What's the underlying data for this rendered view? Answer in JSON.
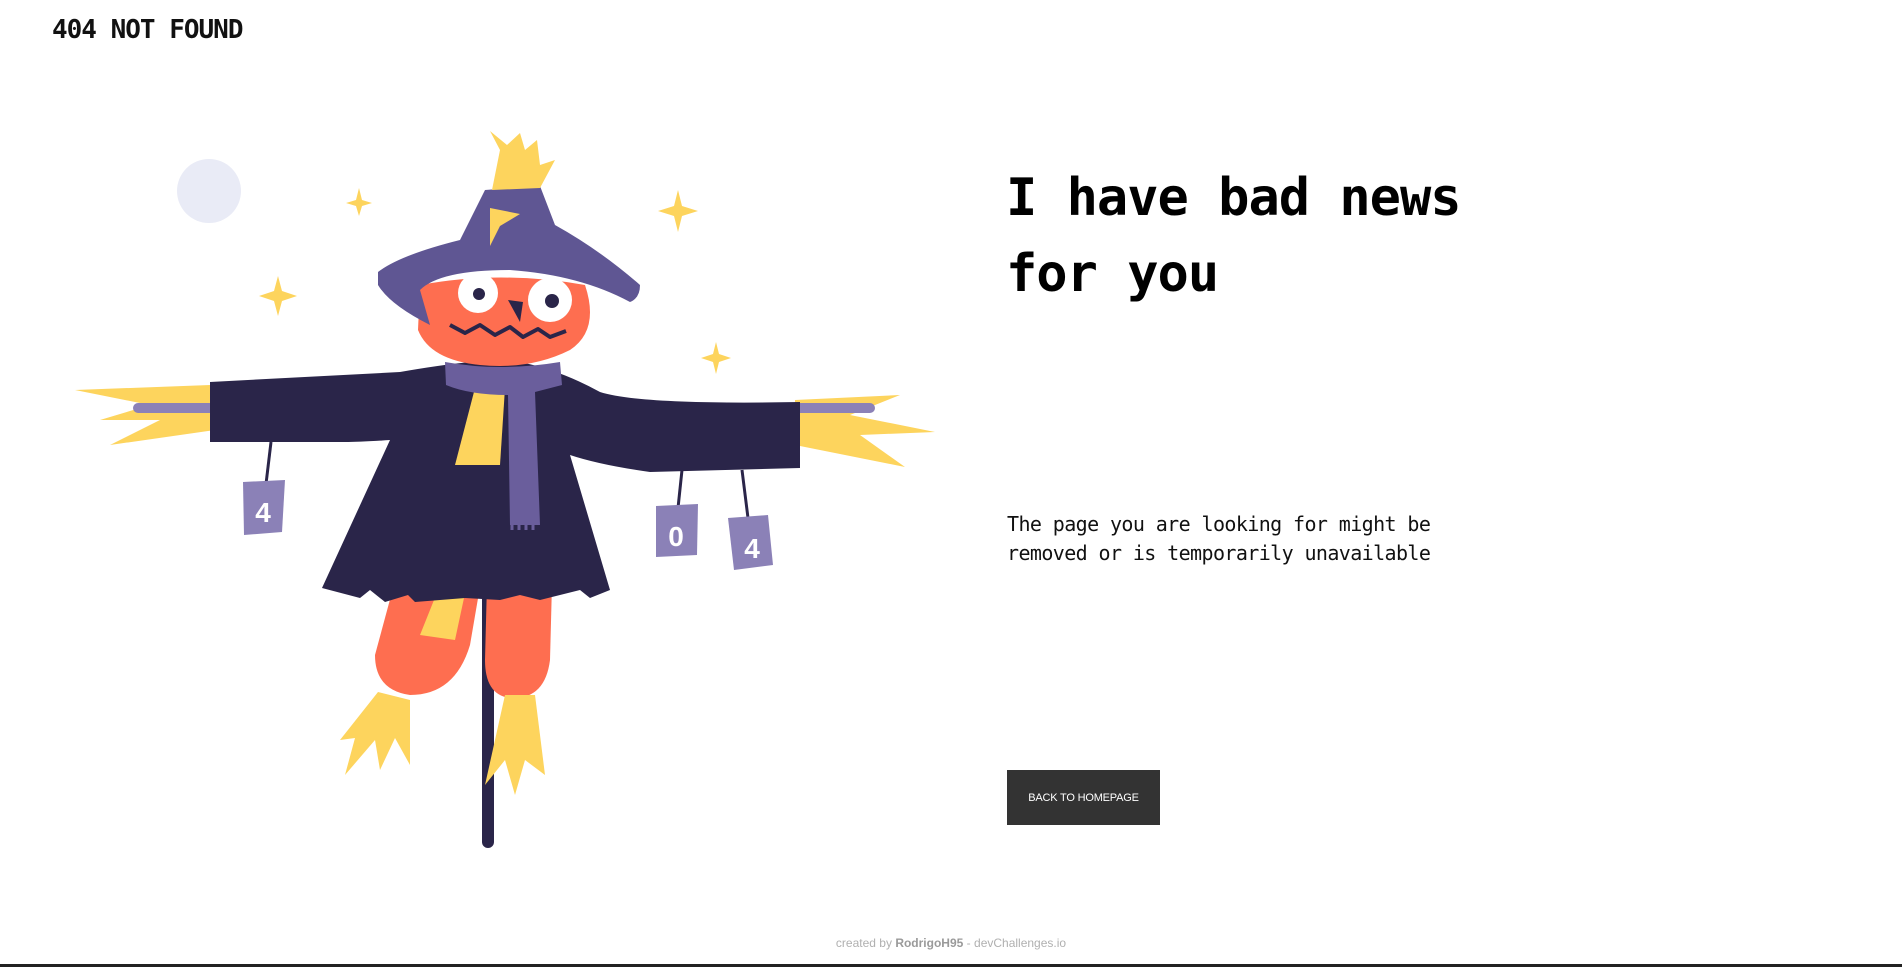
{
  "brand": {
    "label": "404 NOT FOUND"
  },
  "main": {
    "headline": "I have bad news for you",
    "message": "The page you are looking for might be removed or is temporarily unavailable",
    "cta_label": "BACK TO HOMEPAGE"
  },
  "illustration": {
    "can_labels": [
      "4",
      "0",
      "4"
    ]
  },
  "footer": {
    "prefix": "created by",
    "author": "RodrigoH95",
    "separator": "-",
    "site": "devChallenges.io"
  },
  "colors": {
    "moon": "#e9ebf6",
    "star": "#fdd45d",
    "hat": "#5f5693",
    "face": "#fe6e50",
    "coat": "#2a2549",
    "scarf": "#6a5e9c",
    "straw": "#fdd45d",
    "can": "#8b81b7",
    "pole": "#2a2549",
    "button": "#333333",
    "footer_text": "#b0b0b0"
  }
}
